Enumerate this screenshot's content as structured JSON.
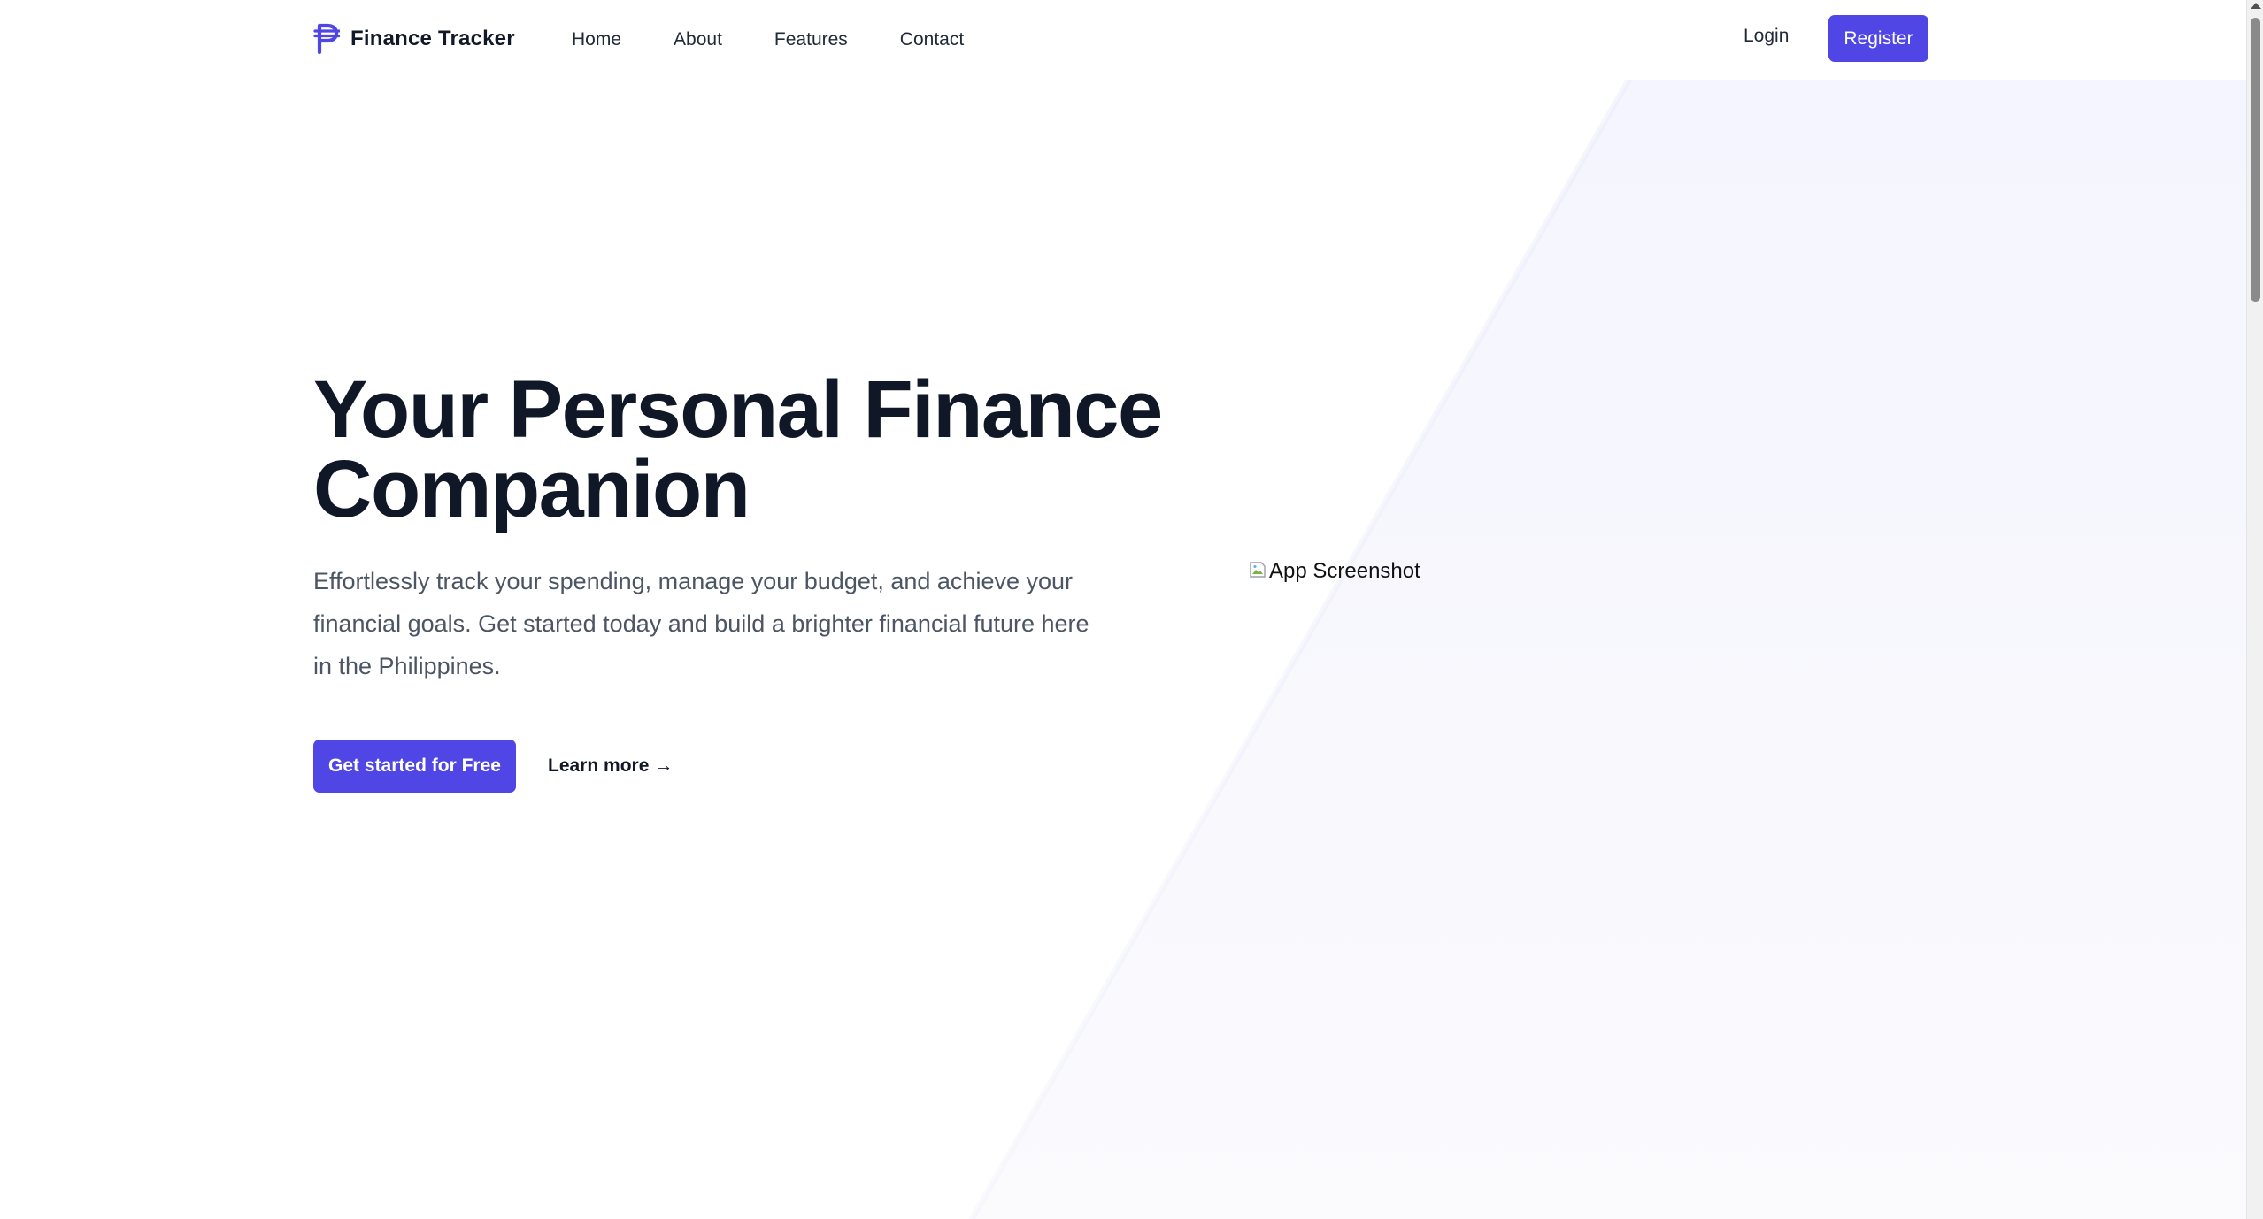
{
  "brand": {
    "name": "Finance Tracker",
    "icon": "peso-sign-icon",
    "color": "#4f46e5"
  },
  "nav": {
    "items": [
      {
        "label": "Home"
      },
      {
        "label": "About"
      },
      {
        "label": "Features"
      },
      {
        "label": "Contact"
      }
    ]
  },
  "auth": {
    "login_label": "Login",
    "register_label": "Register"
  },
  "hero": {
    "title": "Your Personal Finance Companion",
    "description": "Effortlessly track your spending, manage your budget, and achieve your financial goals. Get started today and build a brighter financial future here in the Philippines.",
    "cta_primary": "Get started for Free",
    "cta_secondary": "Learn more",
    "cta_secondary_arrow": "→"
  },
  "app_screenshot": {
    "alt_text": "App Screenshot",
    "icon": "broken-image-icon"
  },
  "colors": {
    "accent": "#4f46e5",
    "heading": "#101828",
    "body_text": "#4b5563",
    "background_tint": "#f6f6fd"
  }
}
